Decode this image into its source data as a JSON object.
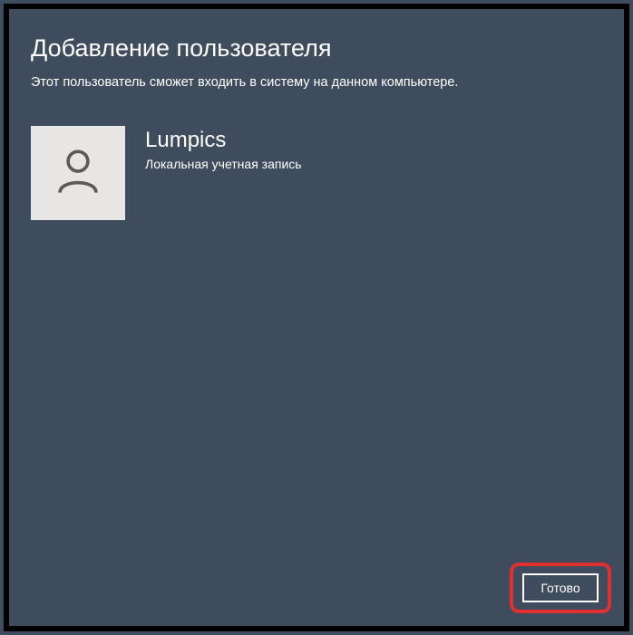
{
  "dialog": {
    "title": "Добавление пользователя",
    "subtitle": "Этот пользователь сможет входить в систему на данном компьютере."
  },
  "user": {
    "name": "Lumpics",
    "account_type": "Локальная учетная запись"
  },
  "actions": {
    "done_label": "Готово"
  }
}
